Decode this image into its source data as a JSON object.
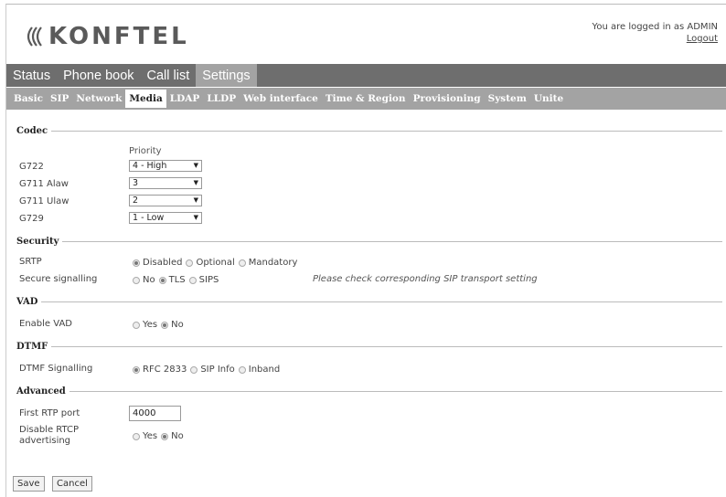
{
  "brand": {
    "logo_text": "KONFTEL"
  },
  "login": {
    "status": "You are logged in as ADMIN",
    "logout": "Logout"
  },
  "main_tabs": [
    {
      "label": "Status"
    },
    {
      "label": "Phone book"
    },
    {
      "label": "Call list"
    },
    {
      "label": "Settings",
      "active": true
    }
  ],
  "sub_tabs": [
    {
      "label": "Basic"
    },
    {
      "label": "SIP"
    },
    {
      "label": "Network"
    },
    {
      "label": "Media",
      "active": true
    },
    {
      "label": "LDAP"
    },
    {
      "label": "LLDP"
    },
    {
      "label": "Web interface"
    },
    {
      "label": "Time & Region"
    },
    {
      "label": "Provisioning"
    },
    {
      "label": "System"
    },
    {
      "label": "Unite"
    }
  ],
  "codec": {
    "title": "Codec",
    "priority_label": "Priority",
    "rows": [
      {
        "label": "G722",
        "value": "4 - High"
      },
      {
        "label": "G711 Alaw",
        "value": "3"
      },
      {
        "label": "G711 Ulaw",
        "value": "2"
      },
      {
        "label": "G729",
        "value": "1 - Low"
      }
    ]
  },
  "security": {
    "title": "Security",
    "srtp": {
      "label": "SRTP",
      "options": [
        "Disabled",
        "Optional",
        "Mandatory"
      ],
      "selected": "Disabled"
    },
    "signalling": {
      "label": "Secure signalling",
      "options": [
        "No",
        "TLS",
        "SIPS"
      ],
      "selected": "TLS",
      "note": "Please check corresponding SIP transport setting"
    }
  },
  "vad": {
    "title": "VAD",
    "enable": {
      "label": "Enable VAD",
      "options": [
        "Yes",
        "No"
      ],
      "selected": "No"
    }
  },
  "dtmf": {
    "title": "DTMF",
    "signalling": {
      "label": "DTMF Signalling",
      "options": [
        "RFC 2833",
        "SIP Info",
        "Inband"
      ],
      "selected": "RFC 2833"
    }
  },
  "advanced": {
    "title": "Advanced",
    "rtp_port": {
      "label": "First RTP port",
      "value": "4000"
    },
    "rtcp": {
      "label_line1": "Disable RTCP",
      "label_line2": "advertising",
      "options": [
        "Yes",
        "No"
      ],
      "selected": "No"
    }
  },
  "buttons": {
    "save": "Save",
    "cancel": "Cancel"
  }
}
